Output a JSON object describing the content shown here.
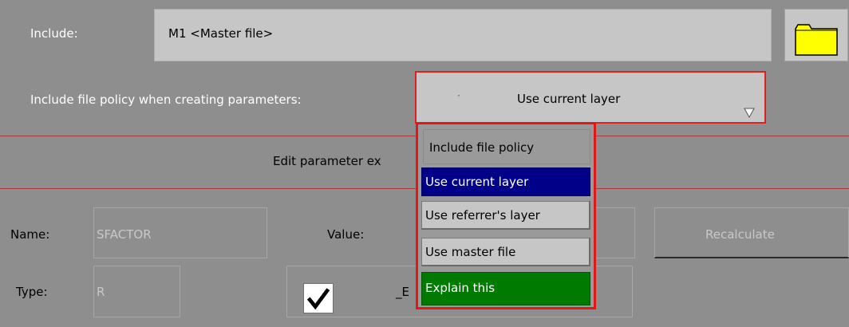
{
  "include": {
    "label": "Include:",
    "value": "M1  <Master file>"
  },
  "policy": {
    "label": "Include file policy when creating parameters:",
    "selected": "Use current layer"
  },
  "section": {
    "title": "Edit parameter ex"
  },
  "param": {
    "name_label": "Name:",
    "name_value": "SFACTOR",
    "value_label": "Value:",
    "recalculate_label": "Recalculate",
    "type_label": "Type:",
    "type_value": "R",
    "bool_label": "_E",
    "checkbox_checked": true
  },
  "dropdown": {
    "title": "Include file policy",
    "items": [
      {
        "label": "Use current layer",
        "state": "selected"
      },
      {
        "label": "Use referrer's layer",
        "state": "normal"
      },
      {
        "label": "Use master file",
        "state": "normal"
      },
      {
        "label": "Explain this",
        "state": "help"
      }
    ]
  },
  "colors": {
    "background": "#8e8e8e",
    "field": "#c6c6c6",
    "highlight_border": "#e01818",
    "selected_item": "#000088",
    "help_item": "#007a00",
    "folder": "#ffff00"
  },
  "icons": {
    "folder": "folder-icon",
    "dropdown_arrow": "dropdown-arrow-icon",
    "checkmark": "checkmark-icon"
  }
}
